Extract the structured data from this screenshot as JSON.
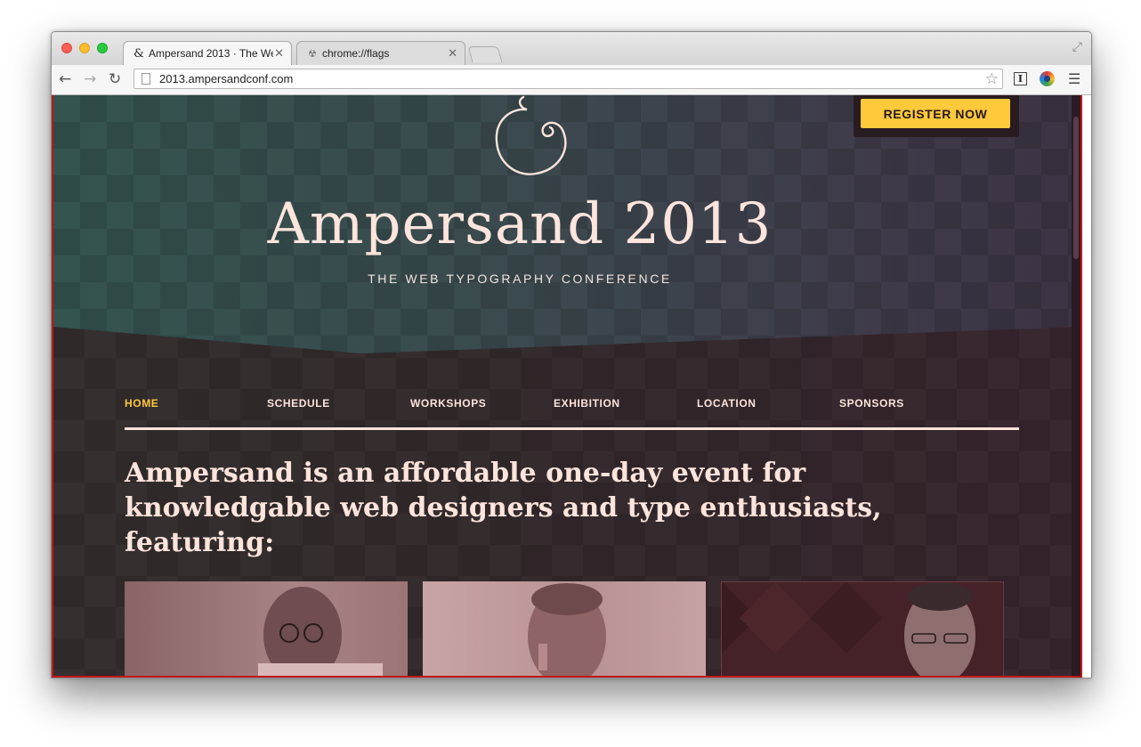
{
  "browser": {
    "tabs": [
      {
        "title": "Ampersand 2013 · The We",
        "favicon": "ampersand-icon"
      },
      {
        "title": "chrome://flags",
        "favicon": "flags-icon"
      }
    ],
    "url": "2013.ampersandconf.com"
  },
  "site": {
    "logo_glyph": "ampersand-swash-logo",
    "title": "Ampersand 2013",
    "subtitle": "THE WEB TYPOGRAPHY CONFERENCE",
    "register_label": "REGISTER NOW",
    "nav": [
      "HOME",
      "SCHEDULE",
      "WORKSHOPS",
      "EXHIBITION",
      "LOCATION",
      "SPONSORS"
    ],
    "active_nav": "HOME",
    "intro": "Ampersand is an affordable one-day event for knowledgable web designers and type enthusiasts, featuring:"
  },
  "colors": {
    "accent": "#ffc93c",
    "text_light": "#fde4dc",
    "hero_teal": "#34544f",
    "dark_band": "#2f2428"
  }
}
